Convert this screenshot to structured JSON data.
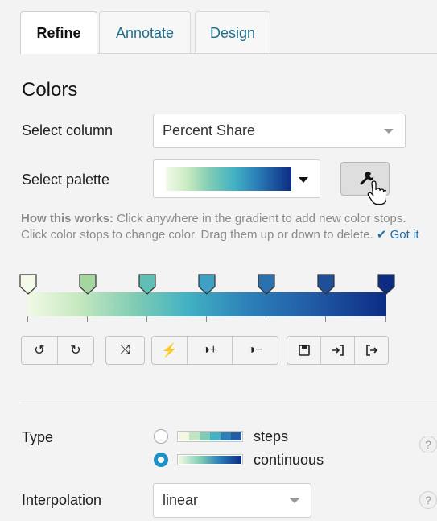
{
  "tabs": [
    {
      "label": "Refine",
      "active": true
    },
    {
      "label": "Annotate",
      "active": false
    },
    {
      "label": "Design",
      "active": false
    }
  ],
  "colors": {
    "title": "Colors",
    "select_column_label": "Select column",
    "select_column_value": "Percent Share",
    "select_palette_label": "Select palette",
    "palette_gradient": [
      "#f1f9e5",
      "#c7e9c0",
      "#7fccb4",
      "#41b1c4",
      "#2c7fb8",
      "#225ea8",
      "#0c2c84"
    ]
  },
  "help": {
    "strong": "How this works:",
    "text": " Click anywhere in the gradient to add new color stops. Click color stops to change color. Drag them up or down to delete. ",
    "got_it": "✔ Got it"
  },
  "color_stops": [
    "#f3fae9",
    "#a6d6a0",
    "#5fbfb4",
    "#3fa0c3",
    "#2b71b0",
    "#1f4f99",
    "#0c2c84"
  ],
  "toolbar": {
    "undo": "↺",
    "redo": "↻",
    "shuffle": "⤨",
    "auto": "⚡",
    "contrast_plus": "◑+",
    "contrast_minus": "◑−",
    "save": "💾",
    "import": "⇥",
    "export": "⇥"
  },
  "type": {
    "label": "Type",
    "options": [
      {
        "label": "steps",
        "checked": false
      },
      {
        "label": "continuous",
        "checked": true
      }
    ],
    "steps_colors": [
      "#f1f9e5",
      "#c2e6c0",
      "#7fccb4",
      "#41b1c4",
      "#2c7fb8",
      "#225ea8"
    ]
  },
  "interpolation": {
    "label": "Interpolation",
    "value": "linear"
  },
  "help_icon": "?"
}
